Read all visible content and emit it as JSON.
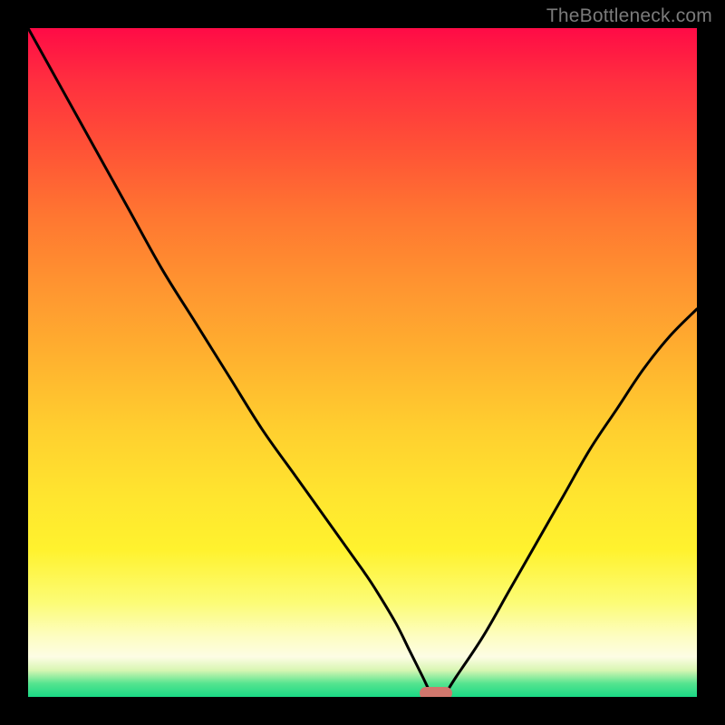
{
  "watermark": {
    "text": "TheBottleneck.com"
  },
  "colors": {
    "page_bg": "#000000",
    "watermark": "#7b7b7b",
    "curve": "#000000",
    "marker": "#d1776d",
    "gradient_top": "#ff0b46",
    "gradient_bottom": "#1ad885"
  },
  "chart_data": {
    "type": "line",
    "title": "",
    "xlabel": "",
    "ylabel": "",
    "xlim": [
      0,
      100
    ],
    "ylim": [
      0,
      100
    ],
    "grid": false,
    "series": [
      {
        "name": "bottleneck-curve",
        "x": [
          0,
          5,
          10,
          15,
          20,
          25,
          30,
          35,
          40,
          45,
          50,
          52,
          55,
          57,
          59,
          60,
          61,
          62,
          64,
          68,
          72,
          76,
          80,
          84,
          88,
          92,
          96,
          100
        ],
        "values": [
          100,
          91,
          82,
          73,
          64,
          56,
          48,
          40,
          33,
          26,
          19,
          16,
          11,
          7,
          3,
          1,
          0,
          0,
          3,
          9,
          16,
          23,
          30,
          37,
          43,
          49,
          54,
          58
        ]
      }
    ],
    "annotations": [
      {
        "name": "optimal-marker",
        "x": 61,
        "y": 0.5
      }
    ]
  }
}
